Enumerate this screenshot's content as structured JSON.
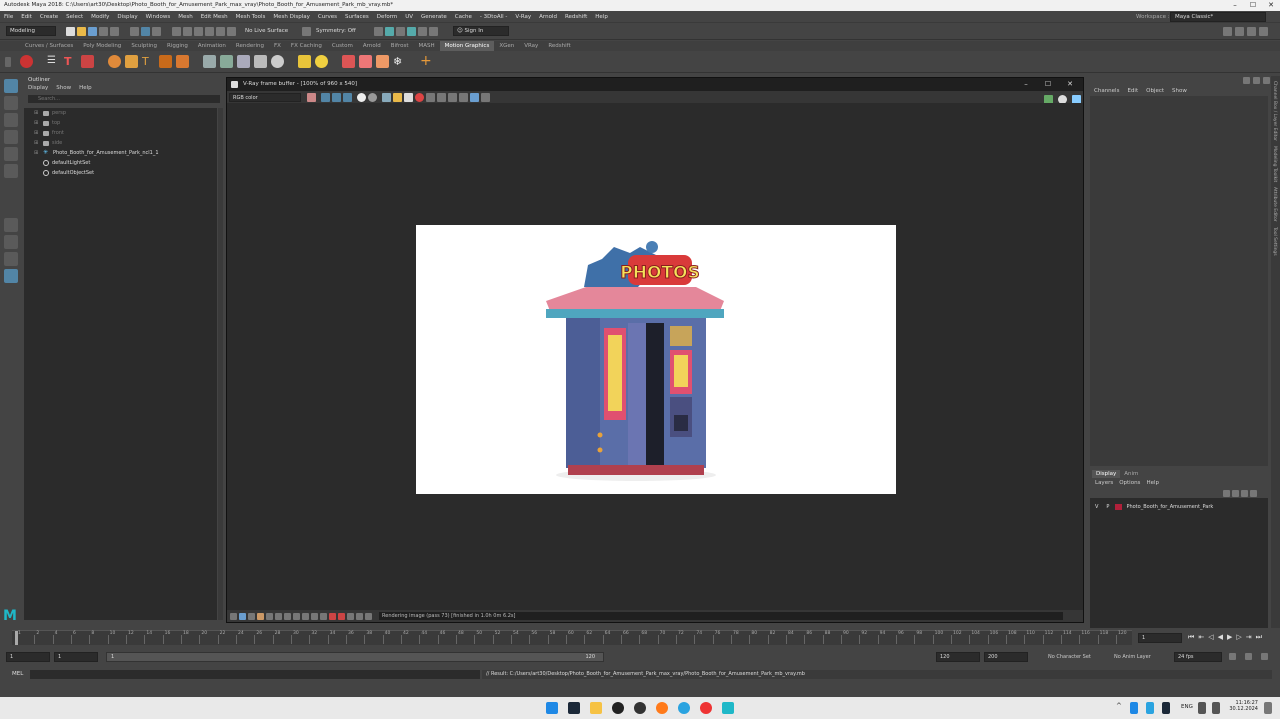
{
  "app": {
    "title": "Autodesk Maya 2018: C:\\Users\\art30\\Desktop\\Photo_Booth_for_Amusement_Park_max_vray\\Photo_Booth_for_Amusement_Park_mb_vray.mb*",
    "workspace_label": "Workspace :",
    "workspace_value": "Maya Classic*"
  },
  "menus": [
    "File",
    "Edit",
    "Create",
    "Select",
    "Modify",
    "Display",
    "Windows",
    "Mesh",
    "Edit Mesh",
    "Mesh Tools",
    "Mesh Display",
    "Curves",
    "Surfaces",
    "Deform",
    "UV",
    "Generate",
    "Cache",
    "- 3DtoAll -",
    "V-Ray",
    "Arnold",
    "Redshift",
    "Help"
  ],
  "status": {
    "mode": "Modeling",
    "live_surface": "No Live Surface",
    "symmetry": "Symmetry: Off",
    "sign_in": "Sign In"
  },
  "shelf_tabs": [
    "Curves / Surfaces",
    "Poly Modeling",
    "Sculpting",
    "Rigging",
    "Animation",
    "Rendering",
    "FX",
    "FX Caching",
    "Custom",
    "Arnold",
    "Bifrost",
    "MASH",
    "Motion Graphics",
    "XGen",
    "VRay",
    "Redshift"
  ],
  "shelf_active": "Motion Graphics",
  "outliner": {
    "title": "Outliner",
    "menu": [
      "Display",
      "Show",
      "Help"
    ],
    "search_placeholder": "Search...",
    "items": [
      {
        "label": "persp",
        "dim": true,
        "type": "camera"
      },
      {
        "label": "top",
        "dim": true,
        "type": "camera"
      },
      {
        "label": "front",
        "dim": true,
        "type": "camera"
      },
      {
        "label": "side",
        "dim": true,
        "type": "camera"
      },
      {
        "label": "Photo_Booth_for_Amusement_Park_ncl1_1",
        "dim": false,
        "type": "group"
      },
      {
        "label": "defaultLightSet",
        "dim": false,
        "type": "set"
      },
      {
        "label": "defaultObjectSet",
        "dim": false,
        "type": "set"
      }
    ]
  },
  "vfb": {
    "title": "V-Ray frame buffer - [100% of 960 x 540]",
    "channel": "RGB color",
    "status_msg": "Rendering image (pass 73) [finished in 1.0h  0m  6.2s]",
    "sign_text": "PHOTOS"
  },
  "right_panel": {
    "menu": [
      "Channels",
      "Edit",
      "Object",
      "Show"
    ],
    "tabs": [
      "Display",
      "Anim"
    ],
    "active_tab": "Display",
    "layer_menu": [
      "Layers",
      "Options",
      "Help"
    ],
    "layer": {
      "v": "V",
      "p": "P",
      "name": "Photo_Booth_for_Amusement_Park",
      "color": "#b0203a"
    }
  },
  "side_tabs": [
    "Channel Box / Layer Editor",
    "Modeling Toolkit",
    "Attribute Editor",
    "Tool Settings"
  ],
  "timeline": {
    "ticks": [
      "1",
      "2",
      "4",
      "6",
      "8",
      "10",
      "12",
      "14",
      "16",
      "18",
      "20",
      "22",
      "24",
      "26",
      "28",
      "30",
      "32",
      "34",
      "36",
      "38",
      "40",
      "42",
      "44",
      "46",
      "48",
      "50",
      "52",
      "54",
      "56",
      "58",
      "60",
      "62",
      "64",
      "66",
      "68",
      "70",
      "72",
      "74",
      "76",
      "78",
      "80",
      "82",
      "84",
      "86",
      "88",
      "90",
      "92",
      "94",
      "96",
      "98",
      "100",
      "102",
      "104",
      "106",
      "108",
      "110",
      "112",
      "114",
      "116",
      "118",
      "120"
    ],
    "current_frame": "1"
  },
  "range": {
    "start": "1",
    "inner_start": "1",
    "slider_start": "1",
    "slider_end": "120",
    "end": "120",
    "anim_end": "200",
    "char_set": "No Character Set",
    "anim_layer": "No Anim Layer",
    "fps": "24 fps"
  },
  "cmd": {
    "label": "MEL",
    "result": "// Result: C:/Users/art30/Desktop/Photo_Booth_for_Amusement_Park_max_vray/Photo_Booth_for_Amusement_Park_mb_vray.mb"
  },
  "taskbar": {
    "lang": "ENG",
    "time": "11:16:27",
    "date": "30.12.2024"
  }
}
